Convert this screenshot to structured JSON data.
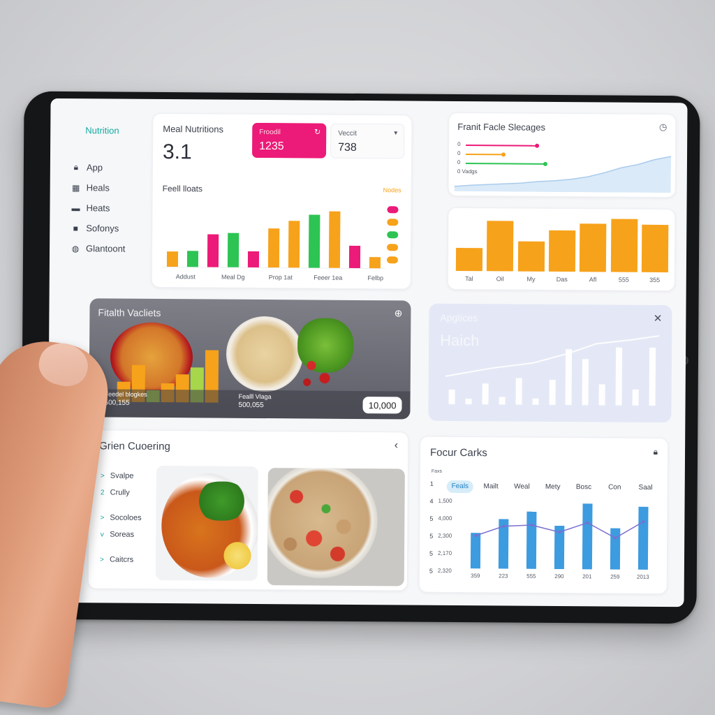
{
  "sidebar": {
    "brand": "Nutrition",
    "items": [
      {
        "icon": "lock-icon",
        "glyph": "🔒︎",
        "label": "App"
      },
      {
        "icon": "grid-icon",
        "glyph": "▦",
        "label": "Heals"
      },
      {
        "icon": "wallet-icon",
        "glyph": "▬",
        "label": "Heats"
      },
      {
        "icon": "document-icon",
        "glyph": "■",
        "label": "Sofonys"
      },
      {
        "icon": "globe-icon",
        "glyph": "◍",
        "label": "Glantoont"
      }
    ]
  },
  "meal_card": {
    "title": "Meal Nutritions",
    "value": "3.1",
    "badge": {
      "label": "Froodil",
      "value": "1235",
      "color": "#ec1a78"
    },
    "secondary": {
      "label": "Veccit",
      "value": "738"
    },
    "section_label": "Feell lloats",
    "legend_label": "Nodes",
    "chart_data": {
      "type": "bar",
      "categories": [
        "Addust",
        "Meal Dg",
        "Prop 1at",
        "Feeer 1ea",
        "Felbp"
      ],
      "values": [
        24,
        26,
        52,
        55,
        26,
        62,
        74,
        84,
        90,
        36,
        18
      ],
      "colors": [
        "#f7a21b",
        "#2dc453",
        "#ec1a78",
        "#2dc453",
        "#ec1a78",
        "#f7a21b",
        "#f7a21b",
        "#2dc453",
        "#f7a21b",
        "#ec1a78",
        "#f7a21b"
      ],
      "ylim": [
        0,
        100
      ]
    },
    "dot_colors": [
      "#ec1a78",
      "#f7a21b",
      "#2dc453",
      "#f7a21b",
      "#f7a21b"
    ]
  },
  "trend_card": {
    "title": "Franit Facle Slecages",
    "legend": [
      {
        "label": "0",
        "color": "#ec1a78",
        "line": 0.85
      },
      {
        "label": "0",
        "color": "#f7a21b",
        "line": 0.45
      },
      {
        "label": "0",
        "color": "#2dc453",
        "line": 0.95
      },
      {
        "label": "0 Vadgs",
        "color": "#b9c6d8",
        "line": 0
      }
    ],
    "chart_data": {
      "type": "area",
      "values": [
        5,
        8,
        10,
        12,
        14,
        18,
        20,
        24,
        30,
        40,
        52,
        60,
        72,
        80
      ],
      "ylim": [
        0,
        100
      ]
    }
  },
  "orange_card": {
    "chart_data": {
      "type": "bar",
      "categories": [
        "Tal",
        "Oil",
        "My",
        "Das",
        "Afl",
        "555",
        "355"
      ],
      "values": [
        42,
        92,
        55,
        76,
        88,
        98,
        87
      ],
      "color": "#f7a21b",
      "ylim": [
        0,
        100
      ]
    }
  },
  "health_card": {
    "title": "Fitalth Vacliets",
    "caption1": "Feedel blogkes",
    "caption1_value": "500,155",
    "caption2": "Fealll Vlaga",
    "caption2_value": "500,055",
    "pill": "10,000",
    "chart_data": {
      "type": "bar",
      "values": [
        30,
        55,
        18,
        28,
        42,
        52,
        78
      ],
      "colors": [
        "#f7a21b",
        "#f7a21b",
        "#a8d64a",
        "#f7a21b",
        "#f7a21b",
        "#a8d64a",
        "#f7a21b"
      ],
      "ylim": [
        0,
        100
      ]
    }
  },
  "faded_card": {
    "title": "Apgtices",
    "subtitle": "Haich",
    "chart_data": {
      "type": "bar",
      "values": [
        22,
        8,
        32,
        12,
        40,
        10,
        38,
        85,
        70,
        32,
        88,
        25,
        88
      ],
      "ylim": [
        0,
        100
      ]
    }
  },
  "list_card": {
    "title": "Grien Cuoering",
    "items": [
      "Svalpe",
      "Crully",
      "Socoloes",
      "Soreas",
      "Caitcrs"
    ],
    "markers": [
      ">",
      "2",
      ">",
      "v",
      ">"
    ]
  },
  "focus_card": {
    "title": "Focur Carks",
    "corner": "Faxs",
    "tabs": [
      "Feals",
      "Mailt",
      "Weal",
      "Mety",
      "Bosc",
      "Con",
      "Saal"
    ],
    "chart_data": {
      "type": "bar",
      "x": [
        "359",
        "223",
        "555",
        "290",
        "201",
        "259",
        "2013"
      ],
      "y_ticks": [
        {
          "n": "1",
          "v": ""
        },
        {
          "n": "4",
          "v": "1,500"
        },
        {
          "n": "5",
          "v": "4,000"
        },
        {
          "n": "5",
          "v": "2,300"
        },
        {
          "n": "5",
          "v": "2,170"
        },
        {
          "n": "5",
          "v": "2,320"
        }
      ],
      "values": [
        52,
        72,
        84,
        63,
        96,
        60,
        92
      ],
      "line": [
        48,
        62,
        64,
        54,
        68,
        46,
        70
      ],
      "bar_color": "#3d9be0",
      "line_color": "#7a6fd0",
      "ylim": [
        0,
        100
      ]
    }
  }
}
